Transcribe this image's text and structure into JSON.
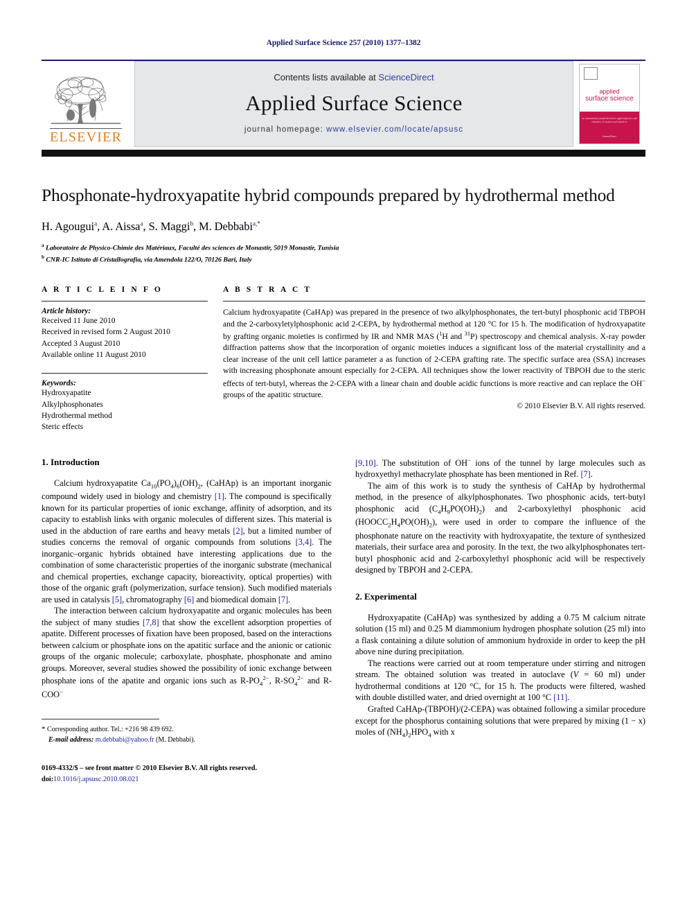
{
  "running_head": "Applied Surface Science 257 (2010) 1377–1382",
  "masthead": {
    "contents_prefix": "Contents lists available at ",
    "sciencedirect": "ScienceDirect",
    "journal_name": "Applied Surface Science",
    "homepage_prefix": "journal homepage: ",
    "homepage_url": "www.elsevier.com/locate/apsusc",
    "publisher_wordmark": "ELSEVIER",
    "publisher_color": "#E87C1E",
    "cover": {
      "line1": "applied",
      "line2": "surface science",
      "accent_color": "#C8134B",
      "sub_line": "an international journal devoted to applied\nphysics and chemistry of surfaces and interfaces",
      "footer_line": "ScienceDirect"
    }
  },
  "article": {
    "title": "Phosphonate-hydroxyapatite hybrid compounds prepared by hydrothermal method",
    "authors": [
      {
        "name": "H. Agougui",
        "marks": "a"
      },
      {
        "name": "A. Aissa",
        "marks": "a"
      },
      {
        "name": "S. Maggi",
        "marks": "b"
      },
      {
        "name": "M. Debbabi",
        "marks": "a,*"
      }
    ],
    "affiliations": [
      {
        "mark": "a",
        "text": "Laboratoire de Physico-Chimie des Matériaux, Faculté des sciences de Monastir, 5019 Monastir, Tunisia"
      },
      {
        "mark": "b",
        "text": "CNR-IC Istituto di Cristallografia, via Amendola 122/O, 70126 Bari, Italy"
      }
    ]
  },
  "article_info": {
    "heading": "A R T I C L E    I N F O",
    "history_title": "Article history:",
    "history": [
      "Received 11 June 2010",
      "Received in revised form 2 August 2010",
      "Accepted 3 August 2010",
      "Available online 11 August 2010"
    ],
    "keywords_title": "Keywords:",
    "keywords": [
      "Hydroxyapatite",
      "Alkylphosphonates",
      "Hydrothermal method",
      "Steric effects"
    ]
  },
  "abstract": {
    "heading": "A B S T R A C T",
    "parts": [
      {
        "t": "Calcium hydroxyapatite (CaHAp) was prepared in the presence of two alkylphosphonates, the tert-butyl phosphonic acid TBPOH and the 2-carboxyletylphosphonic acid 2-CEPA, by hydrothermal method at 120 °C for 15 h. The modification of hydroxyapatite by grafting organic moieties is confirmed by IR and NMR MAS ("
      },
      {
        "sup": "1"
      },
      {
        "t": "H and "
      },
      {
        "sup": "31"
      },
      {
        "t": "P) spectroscopy and chemical analysis. X-ray powder diffraction patterns show that the incorporation of organic moieties induces a significant loss of the material crystallinity and a clear increase of the unit cell lattice parameter a as function of 2-CEPA grafting rate. The specific surface area (SSA) increases with increasing phosphonate amount especially for 2-CEPA. All techniques show the lower reactivity of TBPOH due to the steric effects of tert-butyl, whereas the 2-CEPA with a linear chain and double acidic functions is more reactive and can replace the OH"
      },
      {
        "sup": "−"
      },
      {
        "t": " groups of the apatitic structure."
      }
    ],
    "copyright": "© 2010 Elsevier B.V. All rights reserved."
  },
  "sections": {
    "introduction_heading": "1.  Introduction",
    "experimental_heading": "2.  Experimental"
  },
  "paragraphs": {
    "intro_p1": [
      {
        "t": "Calcium hydroxyapatite Ca"
      },
      {
        "sub": "10"
      },
      {
        "t": "(PO"
      },
      {
        "sub": "4"
      },
      {
        "t": ")"
      },
      {
        "sub": "6"
      },
      {
        "t": "(OH)"
      },
      {
        "sub": "2"
      },
      {
        "t": ", (CaHAp) is an important inorganic compound widely used in biology and chemistry "
      },
      {
        "cite": "[1]"
      },
      {
        "t": ". The compound is specifically known for its particular properties of ionic exchange, affinity of adsorption, and its capacity to establish links with organic molecules of different sizes. This material is used in the abduction of rare earths and heavy metals "
      },
      {
        "cite": "[2]"
      },
      {
        "t": ", but a limited number of studies concerns the removal of organic compounds from solutions "
      },
      {
        "cite": "[3,4]"
      },
      {
        "t": ". The inorganic–organic hybrids obtained have interesting applications due to the combination of some characteristic properties of the inorganic substrate (mechanical and chemical properties, exchange capacity, bioreactivity, optical properties) with those of the organic graft (polymerization, surface tension). Such modified materials are used in catalysis "
      },
      {
        "cite": "[5]"
      },
      {
        "t": ", chromatography "
      },
      {
        "cite": "[6]"
      },
      {
        "t": " and biomedical domain "
      },
      {
        "cite": "[7]"
      },
      {
        "t": "."
      }
    ],
    "intro_p2": [
      {
        "t": "The interaction between calcium hydroxyapatite and organic molecules has been the subject of many studies "
      },
      {
        "cite": "[7,8]"
      },
      {
        "t": " that show the excellent adsorption properties of apatite. Different processes of fixation have been proposed, based on the interactions between calcium or phosphate ions on the apatitic surface and the anionic or cationic groups of the organic molecule; carboxylate, phosphate, phosphonate and amino groups. Moreover, several studies showed the possibility of ionic exchange between phosphate ions of the apatite and organic ions such as R-PO"
      },
      {
        "sub": "4"
      },
      {
        "sup": "2−"
      },
      {
        "t": ", R-SO"
      },
      {
        "sub": "4"
      },
      {
        "sup": "2−"
      },
      {
        "t": " and R-COO"
      },
      {
        "sup": "−"
      }
    ],
    "intro_p2_cont": [
      {
        "cite": "[9,10]"
      },
      {
        "t": ". The substitution of OH"
      },
      {
        "sup": "−"
      },
      {
        "t": " ions of the tunnel by large molecules such as hydroxyethyl methacrylate phosphate has been mentioned in Ref. "
      },
      {
        "cite": "[7]"
      },
      {
        "t": "."
      }
    ],
    "intro_p3": [
      {
        "t": "The aim of this work is to study the synthesis of CaHAp by hydrothermal method, in the presence of alkylphosphonates. Two phosphonic acids, tert-butyl phosphonic acid (C"
      },
      {
        "sub": "4"
      },
      {
        "t": "H"
      },
      {
        "sub": "9"
      },
      {
        "t": "PO(OH)"
      },
      {
        "sub": "2"
      },
      {
        "t": ") and 2-carboxylethyl phosphonic acid (HOOCC"
      },
      {
        "sub": "2"
      },
      {
        "t": "H"
      },
      {
        "sub": "4"
      },
      {
        "t": "PO(OH)"
      },
      {
        "sub": "2"
      },
      {
        "t": "), were used in order to compare the influence of the phosphonate nature on the reactivity with hydroxyapatite, the texture of synthesized materials, their surface area and porosity. In the text, the two alkylphosphonates tert-butyl phosphonic acid and 2-carboxylethyl phosphonic acid will be respectively designed by TBPOH and 2-CEPA."
      }
    ],
    "exp_p1": [
      {
        "t": "Hydroxyapatite (CaHAp) was synthesized by adding a 0.75 M calcium nitrate solution (15 ml) and 0.25 M diammonium hydrogen phosphate solution (25 ml) into a flask containing a dilute solution of ammonium hydroxide in order to keep the pH above nine during precipitation."
      }
    ],
    "exp_p2": [
      {
        "t": "The reactions were carried out at room temperature under stirring and nitrogen stream. The obtained solution was treated in autoclave ("
      },
      {
        "em": "V"
      },
      {
        "t": " = 60 ml) under hydrothermal conditions at 120 °C, for 15 h. The products were filtered, washed with double distilled water, and dried overnight at 100 °C "
      },
      {
        "cite": "[11]"
      },
      {
        "t": "."
      }
    ],
    "exp_p3": [
      {
        "t": "Grafted CaHAp-(TBPOH)/(2-CEPA) was obtained following a similar procedure except for the phosphorus containing solutions that were prepared by mixing (1 − x) moles of (NH"
      },
      {
        "sub": "4"
      },
      {
        "t": ")"
      },
      {
        "sub": "2"
      },
      {
        "t": "HPO"
      },
      {
        "sub": "4"
      },
      {
        "t": " with x"
      }
    ]
  },
  "footnote": {
    "star": "*",
    "corresponding": " Corresponding author. Tel.: +216 98 439 692.",
    "email_label": "E-mail address:",
    "email": "m.debbabi@yahoo.fr",
    "email_owner": " (M. Debbabi)."
  },
  "imprint": {
    "issn_line": "0169-4332/$ – see front matter © 2010 Elsevier B.V. All rights reserved.",
    "doi_label": "doi:",
    "doi": "10.1016/j.apsusc.2010.08.021"
  }
}
